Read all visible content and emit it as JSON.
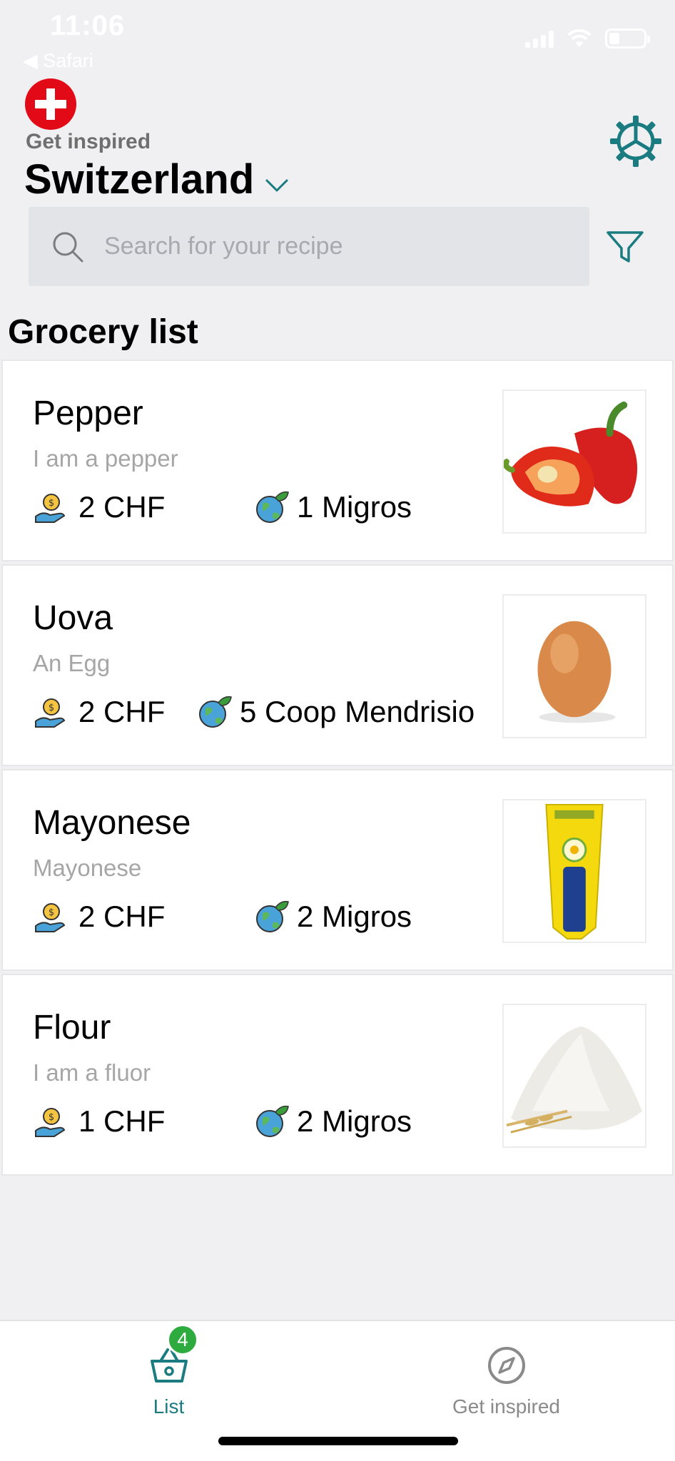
{
  "status_bar": {
    "time": "11:06",
    "back_app": "◀ Safari"
  },
  "header": {
    "subtitle": "Get inspired",
    "country": "Switzerland",
    "flag_icon": "swiss-flag-icon",
    "settings_icon": "gear-icon",
    "accent_color": "#1a7b80"
  },
  "search": {
    "placeholder": "Search for your recipe",
    "filter_icon": "filter-icon"
  },
  "section_title": "Grocery list",
  "items": [
    {
      "name": "Pepper",
      "description": "I am a pepper",
      "price": "2 CHF",
      "store": "1 Migros",
      "image": "red-pepper"
    },
    {
      "name": "Uova",
      "description": "An Egg",
      "price": "2 CHF",
      "store": "5 Coop Mendrisio",
      "image": "egg"
    },
    {
      "name": "Mayonese",
      "description": "Mayonese",
      "price": "2 CHF",
      "store": "2 Migros",
      "image": "mayonnaise-tube"
    },
    {
      "name": "Flour",
      "description": "I am a fluor",
      "price": "1 CHF",
      "store": "2 Migros",
      "image": "flour-pile"
    }
  ],
  "tabbar": {
    "tabs": [
      {
        "label": "List",
        "icon": "basket-icon",
        "badge": "4",
        "active": true
      },
      {
        "label": "Get inspired",
        "icon": "compass-icon",
        "active": false
      }
    ],
    "badge_color": "#2dab3f"
  }
}
